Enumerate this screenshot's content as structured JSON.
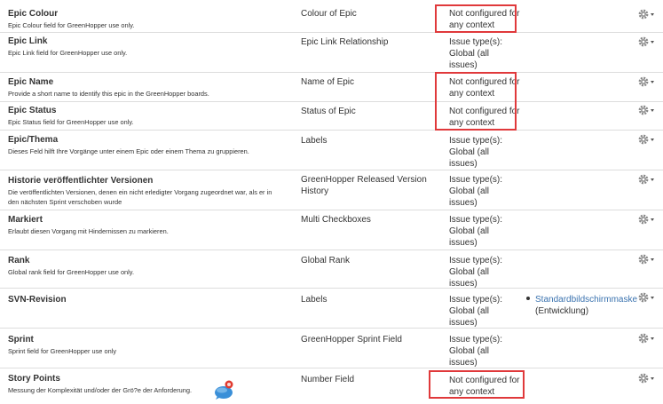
{
  "rows": [
    {
      "name": "Epic Colour",
      "desc": [
        "Epic Colour field for GreenHopper use only."
      ],
      "type": "Colour of Epic",
      "ctx": [
        "Not configured for",
        "any context"
      ],
      "highlight": true
    },
    {
      "name": "Epic Link",
      "desc": [
        "Epic Link field for GreenHopper use only."
      ],
      "type": "Epic Link Relationship",
      "ctx": [
        "Issue type(s):",
        "Global (all",
        "issues)"
      ],
      "highlight": false
    },
    {
      "name": "Epic Name",
      "desc": [
        "Provide a short name to identify this epic in the GreenHopper boards."
      ],
      "type": "Name of Epic",
      "ctx": [
        "Not configured for",
        "any context"
      ],
      "highlight": true
    },
    {
      "name": "Epic Status",
      "desc": [
        "Epic Status field for GreenHopper use only."
      ],
      "type": "Status of Epic",
      "ctx": [
        "Not configured for",
        "any context"
      ],
      "highlight": true
    },
    {
      "name": "Epic/Thema",
      "desc": [
        "Dieses Feld hilft Ihre Vorgänge unter einem Epic oder einem Thema zu gruppieren."
      ],
      "type": "Labels",
      "ctx": [
        "Issue type(s):",
        "Global (all",
        "issues)"
      ],
      "highlight": false
    },
    {
      "name": "Historie veröffentlichter Versionen",
      "desc": [
        "Die veröffentlichten Versionen, denen ein nicht erledigter Vorgang zugeordnet war, als er in",
        "den nächsten Sprint verschoben wurde"
      ],
      "type": "GreenHopper Released Version History",
      "ctx": [
        "Issue type(s):",
        "Global (all",
        "issues)"
      ],
      "highlight": false
    },
    {
      "name": "Markiert",
      "desc": [
        "Erlaubt diesen Vorgang mit Hindernissen zu markieren."
      ],
      "type": "Multi Checkboxes",
      "ctx": [
        "Issue type(s):",
        "Global (all",
        "issues)"
      ],
      "highlight": false
    },
    {
      "name": "Rank",
      "desc": [
        "Global rank field for GreenHopper use only."
      ],
      "type": "Global Rank",
      "ctx": [
        "Issue type(s):",
        "Global (all",
        "issues)"
      ],
      "highlight": false
    },
    {
      "name": "SVN-Revision",
      "desc": [],
      "type": "Labels",
      "ctx": [
        "Issue type(s):",
        "Global (all",
        "issues)"
      ],
      "highlight": false,
      "screen": "Standardbildschirmmaske",
      "screen_sub": "(Entwicklung)"
    },
    {
      "name": "Sprint",
      "desc": [
        "Sprint field for GreenHopper use only"
      ],
      "type": "GreenHopper Sprint Field",
      "ctx": [
        "Issue type(s):",
        "Global (all",
        "issues)"
      ],
      "highlight": false
    },
    {
      "name": "Story Points",
      "desc": [
        "Messung der Komplexität und/oder der Grö?e der Anforderung."
      ],
      "type": "Number Field",
      "ctx": [
        "Not configured for",
        "any context"
      ],
      "highlight": true
    }
  ],
  "colors": {
    "highlight": "#e0393b",
    "link": "#3b73af"
  },
  "icons": {
    "actions": "gear-dropdown-icon",
    "bubble": "chat-bubble-icon"
  }
}
